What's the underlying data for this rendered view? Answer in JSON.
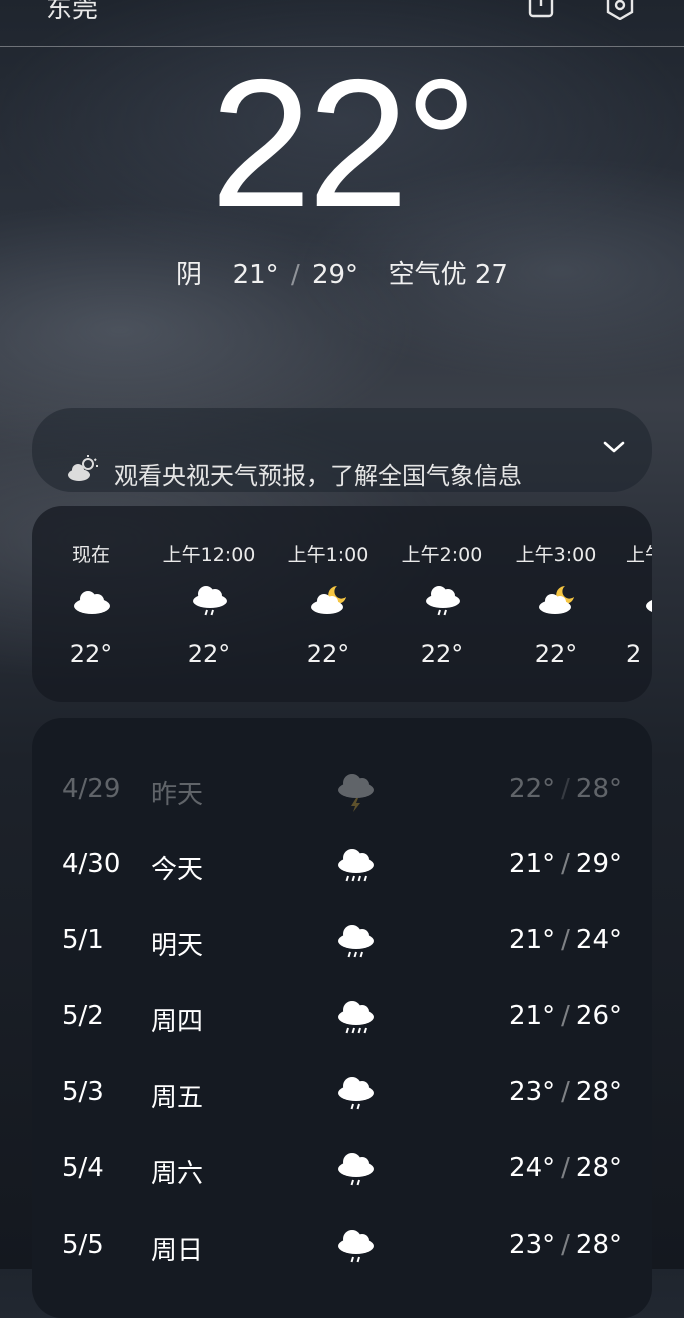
{
  "header": {
    "city": "东莞",
    "icons": [
      "phone-icon",
      "settings-icon"
    ]
  },
  "current": {
    "temperature": "22°",
    "condition": "阴",
    "low": "21°",
    "high": "29°",
    "separator": "/",
    "air_quality": "空气优 27"
  },
  "banner": {
    "icon": "partly-cloudy-icon",
    "text": "观看央视天气预报，了解全国气象信息",
    "chevron": "chevron-down-icon"
  },
  "hourly": [
    {
      "time": "现在",
      "icon": "cloudy-icon",
      "temp": "22°"
    },
    {
      "time": "上午12:00",
      "icon": "light-rain-icon",
      "temp": "22°"
    },
    {
      "time": "上午1:00",
      "icon": "cloudy-moon-icon",
      "temp": "22°"
    },
    {
      "time": "上午2:00",
      "icon": "light-rain-icon",
      "temp": "22°"
    },
    {
      "time": "上午3:00",
      "icon": "cloudy-moon-icon",
      "temp": "22°"
    },
    {
      "time": "上午",
      "icon": "cloudy-icon",
      "temp": "2"
    }
  ],
  "daily": [
    {
      "date": "4/29",
      "day": "昨天",
      "icon": "thunderstorm-icon",
      "low": "22°",
      "high": "28°",
      "past": true
    },
    {
      "date": "4/30",
      "day": "今天",
      "icon": "moderate-rain-icon",
      "low": "21°",
      "high": "29°"
    },
    {
      "date": "5/1",
      "day": "明天",
      "icon": "moderate-rain-icon",
      "low": "21°",
      "high": "24°"
    },
    {
      "date": "5/2",
      "day": "周四",
      "icon": "moderate-rain-icon",
      "low": "21°",
      "high": "26°"
    },
    {
      "date": "5/3",
      "day": "周五",
      "icon": "light-rain-icon",
      "low": "23°",
      "high": "28°"
    },
    {
      "date": "5/4",
      "day": "周六",
      "icon": "light-rain-icon",
      "low": "24°",
      "high": "28°"
    },
    {
      "date": "5/5",
      "day": "周日",
      "icon": "light-rain-icon",
      "low": "23°",
      "high": "28°"
    }
  ],
  "colors": {
    "sun": "#f5c542",
    "cloud": "#ffffff"
  }
}
